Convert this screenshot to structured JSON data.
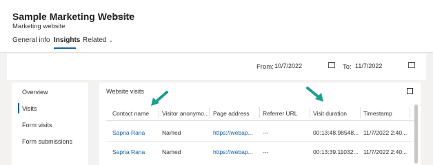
{
  "header": {
    "title": "Sample Marketing Website",
    "saved": "- Saved",
    "subtitle": "Marketing website",
    "tabs": [
      "General info",
      "Insights",
      "Related"
    ]
  },
  "filters": {
    "from_label": "From:",
    "from_value": "10/7/2022",
    "to_label": "To:",
    "to_value": "11/7/2022"
  },
  "nav": {
    "items": [
      "Overview",
      "Visits",
      "Form visits",
      "Form submissions"
    ]
  },
  "visits": {
    "title": "Website visits",
    "columns": [
      "Contact name",
      "Visitor anonymo...",
      "Page address",
      "Referrer URL",
      "Visit duration",
      "Timestamp"
    ],
    "rows": [
      [
        "Sapna Rana",
        "Named",
        "https://webap...",
        "---",
        "00:13:48.98548...",
        "11/7/2022 2:40..."
      ],
      [
        "Sapna Rana",
        "Named",
        "https://webap...",
        "---",
        "00:13:39.11032...",
        "11/7/2022 2:40..."
      ]
    ]
  },
  "colors": {
    "accent": "#115ea3",
    "arrow": "#1b9e8f"
  }
}
